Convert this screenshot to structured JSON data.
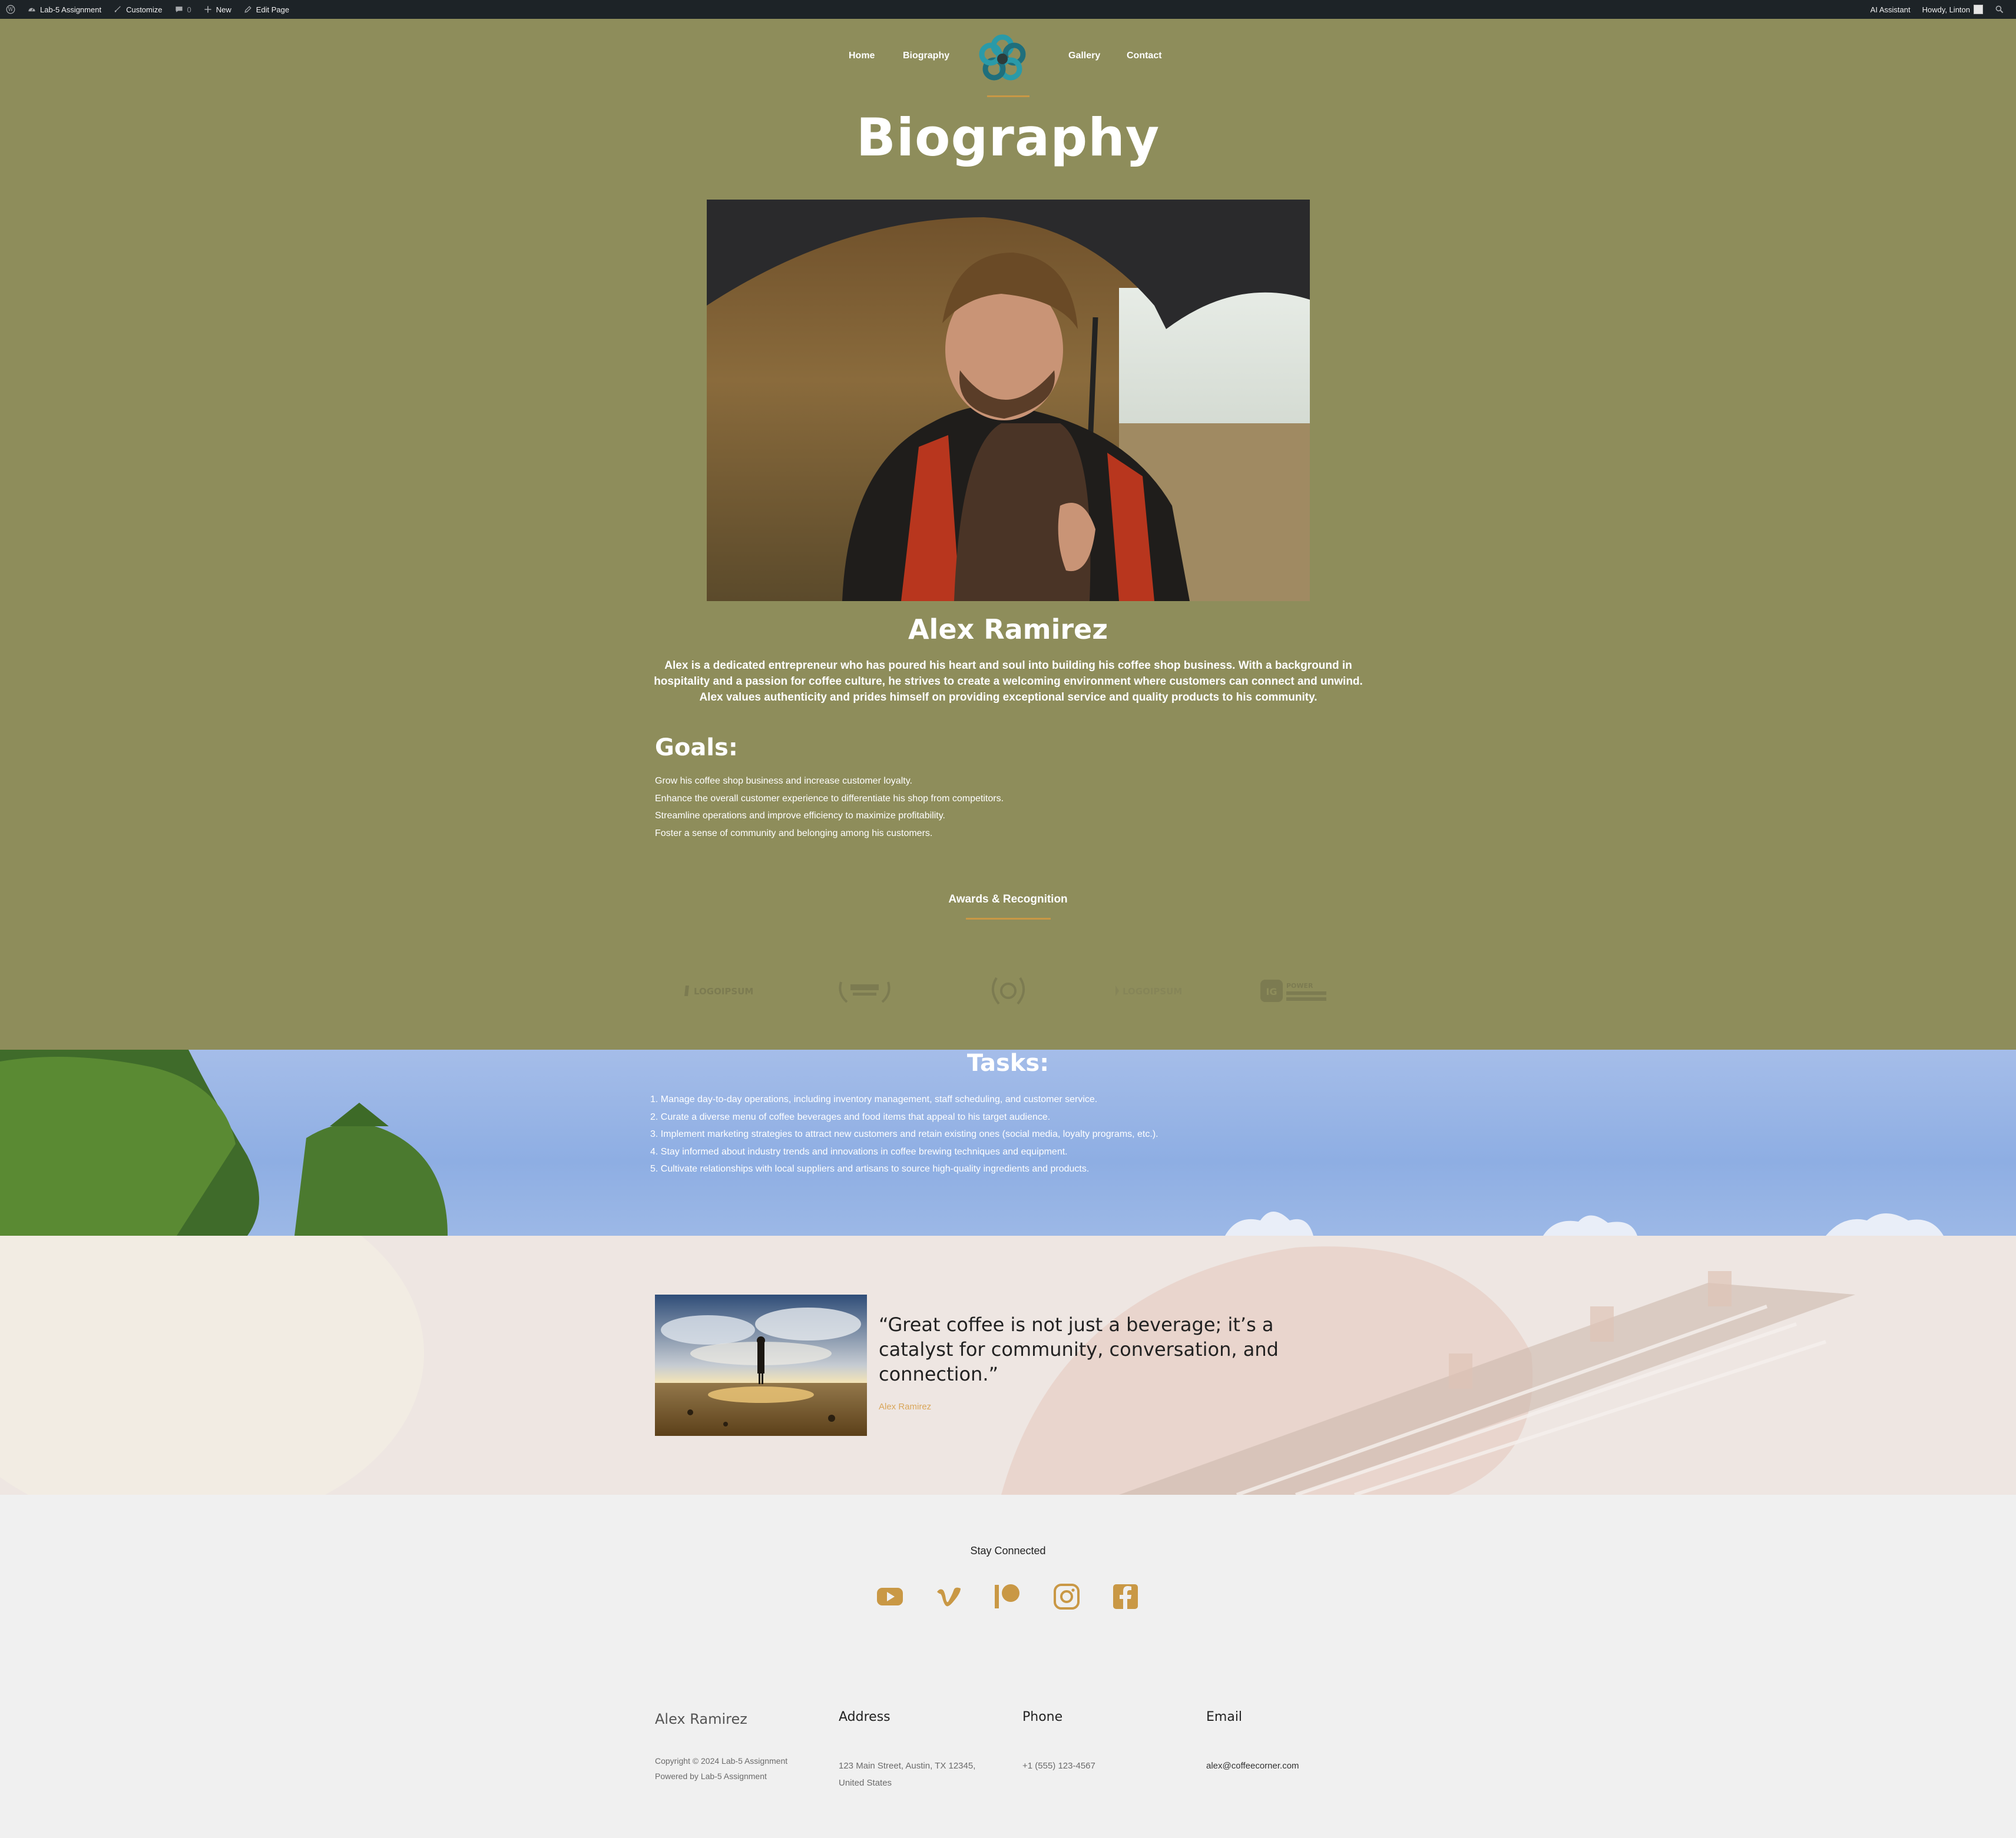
{
  "admin_bar": {
    "site_name": "Lab-5 Assignment",
    "customize": "Customize",
    "comments_count": "0",
    "new": "New",
    "edit_page": "Edit Page",
    "ai_assistant": "AI Assistant",
    "greeting": "Howdy, Linton"
  },
  "nav": {
    "items": [
      "Home",
      "Biography",
      "Gallery",
      "Contact"
    ]
  },
  "page_title": "Biography",
  "person": {
    "name": "Alex Ramirez",
    "bio": "Alex is a dedicated entrepreneur who has poured his heart and soul into building his coffee shop business. With a background in hospitality and a passion for coffee culture, he strives to create a welcoming environment where customers can connect and unwind. Alex values authenticity and prides himself on providing exceptional service and quality products to his community."
  },
  "goals": {
    "heading": "Goals:",
    "items": [
      "Grow his coffee shop business and increase customer loyalty.",
      "Enhance the overall customer experience to differentiate his shop from competitors.",
      "Streamline operations and improve efficiency to maximize profitability.",
      "Foster a sense of community and belonging among his customers."
    ]
  },
  "awards": {
    "title": "Awards & Recognition",
    "logos": [
      "LOGOIPSUM",
      "GLOBAL AWARD",
      "LAUREL",
      "LOGOIPSUM",
      "POWER"
    ]
  },
  "tasks": {
    "heading": "Tasks:",
    "items": [
      "1. Manage day-to-day operations, including inventory management, staff scheduling, and customer service.",
      "2. Curate a diverse menu of coffee beverages and food items that appeal to his target audience.",
      "3. Implement marketing strategies to attract new customers and retain existing ones (social media, loyalty programs, etc.).",
      "4. Stay informed about industry trends and innovations in coffee brewing techniques and equipment.",
      "5. Cultivate relationships with local suppliers and artisans to source high-quality ingredients and products."
    ]
  },
  "quote": {
    "text": "“Great coffee is not just a beverage; it’s a catalyst for community, conversation, and connection.”",
    "author": "Alex Ramirez"
  },
  "social": {
    "title": "Stay Connected",
    "icons": [
      "youtube-icon",
      "vimeo-icon",
      "patreon-icon",
      "instagram-icon",
      "facebook-icon"
    ],
    "color": "#c99845"
  },
  "footer": {
    "brand": "Alex Ramirez",
    "copyright": "Copyright © 2024 Lab-5 Assignment",
    "powered": "Powered by Lab-5 Assignment",
    "address_heading": "Address",
    "address_line1": "123 Main Street, Austin, TX 12345,",
    "address_line2": "United States",
    "phone_heading": "Phone",
    "phone": "+1 (555) 123-4567",
    "email_heading": "Email",
    "email": "alex@coffeecorner.com"
  },
  "colors": {
    "hero_bg": "#8e8d5b",
    "accent": "#c99845",
    "admin_bar": "#1d2327",
    "footer_bg": "#f0f0f0"
  }
}
